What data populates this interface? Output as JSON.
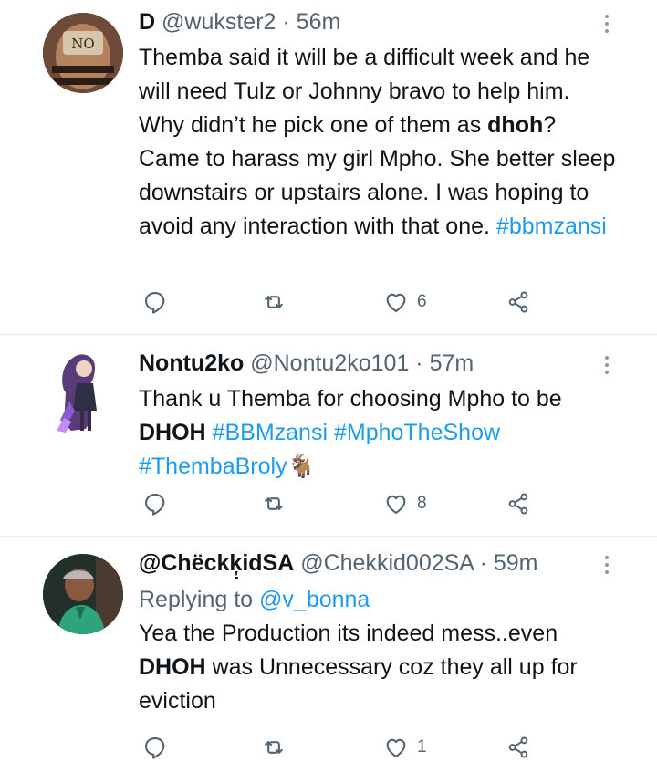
{
  "tweets": [
    {
      "display_name": "D",
      "handle": "@wukster2",
      "separator": "·",
      "time": "56m",
      "avatar_text": "NO",
      "text_parts": [
        "Themba said it will be a difficult week and he will need Tulz or Johnny bravo to help him. Why didn’t he pick one of them as ",
        "dhoh",
        "? Came to harass my girl Mpho. She better sleep downstairs or upstairs alone. I was hoping to avoid any interaction with that one. ",
        "#bbmzansi"
      ],
      "likes": "6"
    },
    {
      "display_name": "Nontu2ko",
      "handle": "@Nontu2ko101",
      "separator": "·",
      "time": "57m",
      "text_parts": [
        "Thank u Themba for choosing Mpho to be ",
        "DHOH",
        " ",
        "#BBMzansi",
        " ",
        "#MphoTheShow",
        "#ThembaBroly",
        "🐐"
      ],
      "likes": "8"
    },
    {
      "display_name": "@Chëckķ̣idSA",
      "handle": "@Chekkid002SA",
      "separator": "·",
      "time": "59m",
      "replying_label": "Replying to",
      "replying_handle": "@v_bonna",
      "text_parts": [
        "Yea the Production its indeed mess..even ",
        "DHOH",
        " was Unnecessary coz they all up for eviction"
      ],
      "likes": "1"
    }
  ],
  "colors": {
    "link": "#1d9bf0",
    "muted": "#536471",
    "divider": "#e6ecf0"
  },
  "icons": [
    "more-icon",
    "reply-icon",
    "retweet-icon",
    "like-icon",
    "share-icon"
  ]
}
